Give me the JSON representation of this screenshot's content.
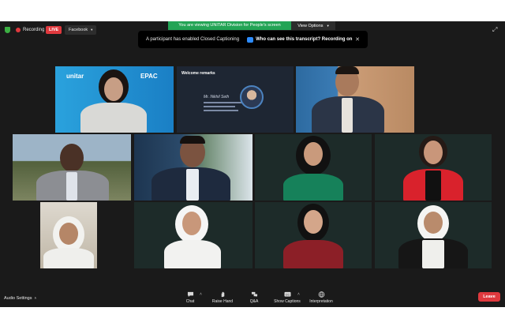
{
  "topbar": {
    "recording_label": "Recording",
    "live_badge": "LIVE",
    "stream_target": "Facebook",
    "viewing_banner": "You are viewing UNITAR Division for People's screen",
    "view_options": "View Options"
  },
  "toast": {
    "message": "A participant has enabled Closed Captioning",
    "link": "Who can see this transcript? Recording on"
  },
  "tiles": {
    "t1": {
      "logo_left": "unitar",
      "logo_right": "EPAC"
    },
    "t2": {
      "slide_title": "Welcome remarks",
      "slide_name": "Mr. Nikhil Seth"
    }
  },
  "toolbar": {
    "audio_settings": "Audio Settings",
    "chat": "Chat",
    "raise_hand": "Raise Hand",
    "qa": "Q&A",
    "show_captions": "Show Captions",
    "interpretation": "Interpretation",
    "leave": "Leave"
  },
  "colors": {
    "accent_green": "#23a455",
    "leave_red": "#e0393e",
    "stage_bg": "#1a1a1a"
  }
}
